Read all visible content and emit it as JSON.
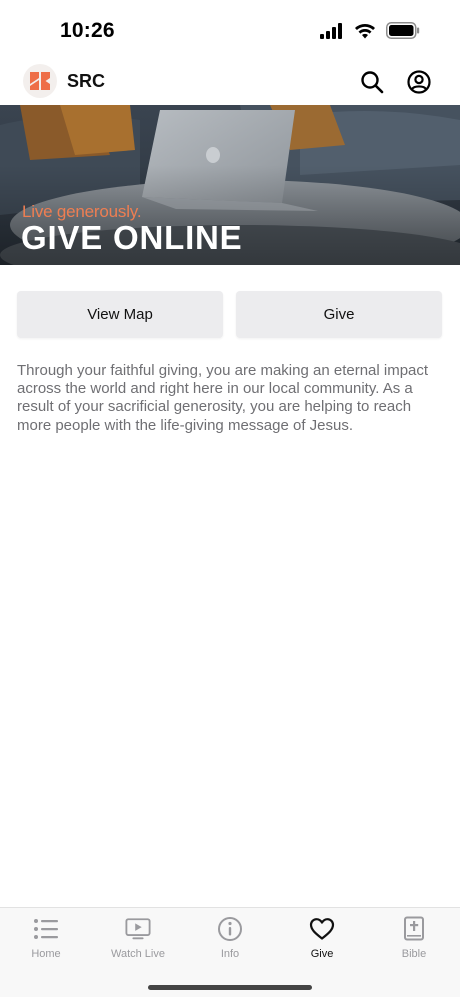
{
  "status_bar": {
    "time": "10:26"
  },
  "header": {
    "title": "SRC"
  },
  "banner": {
    "tagline": "Live generously.",
    "headline": "GIVE ONLINE"
  },
  "actions": {
    "view_map_label": "View Map",
    "give_label": "Give"
  },
  "description": "Through your faithful giving, you are making an eternal impact across the world and right here in our local community. As a result of your sacrificial generosity, you are helping to reach more people with the life-giving message of Jesus.",
  "tab_bar": {
    "tabs": [
      {
        "label": "Home",
        "icon": "list-icon"
      },
      {
        "label": "Watch Live",
        "icon": "tv-play-icon"
      },
      {
        "label": "Info",
        "icon": "info-icon"
      },
      {
        "label": "Give",
        "icon": "heart-icon"
      },
      {
        "label": "Bible",
        "icon": "bible-icon"
      }
    ],
    "active": "Give"
  },
  "colors": {
    "brand": "#ee7e52",
    "active_tab": "#111111",
    "inactive_tab": "#9a9a9e"
  }
}
